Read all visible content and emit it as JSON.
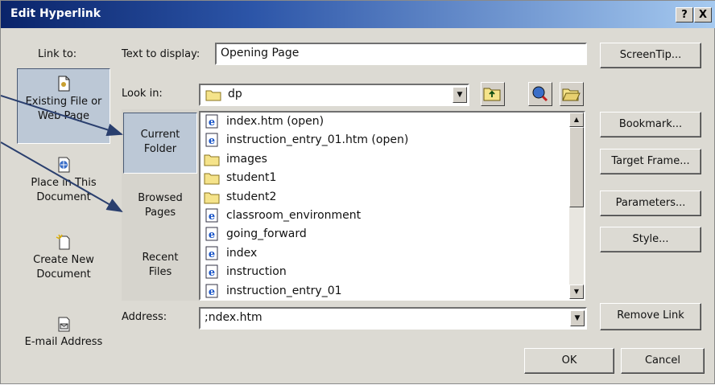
{
  "window": {
    "title": "Edit Hyperlink",
    "help_label": "?",
    "close_label": "X"
  },
  "link_to": {
    "label": "Link to:",
    "items": [
      {
        "name": "existing-file",
        "line1": "Existing File or",
        "line2": "Web Page",
        "icon": "document-icon"
      },
      {
        "name": "place-in-doc",
        "line1": "Place in This",
        "line2": "Document",
        "icon": "globe-document-icon"
      },
      {
        "name": "create-new",
        "line1": "Create New",
        "line2": "Document",
        "icon": "new-document-icon"
      },
      {
        "name": "email",
        "line1": "E-mail Address",
        "line2": "",
        "icon": "email-icon"
      }
    ]
  },
  "text_to_display": {
    "label": "Text to display:",
    "value": "Opening Page"
  },
  "look_in": {
    "label": "Look in:",
    "value": "dp"
  },
  "categories": [
    {
      "line1": "Current",
      "line2": "Folder"
    },
    {
      "line1": "Browsed",
      "line2": "Pages"
    },
    {
      "line1": "Recent",
      "line2": "Files"
    }
  ],
  "files": [
    {
      "name": "index.htm (open)",
      "type": "ie-page-icon"
    },
    {
      "name": "instruction_entry_01.htm (open)",
      "type": "ie-page-icon"
    },
    {
      "name": "images",
      "type": "folder-icon"
    },
    {
      "name": "student1",
      "type": "folder-icon"
    },
    {
      "name": "student2",
      "type": "folder-icon"
    },
    {
      "name": "classroom_environment",
      "type": "ie-page-icon"
    },
    {
      "name": "going_forward",
      "type": "ie-page-icon"
    },
    {
      "name": "index",
      "type": "ie-page-icon"
    },
    {
      "name": "instruction",
      "type": "ie-page-icon"
    },
    {
      "name": "instruction_entry_01",
      "type": "ie-page-icon"
    }
  ],
  "address": {
    "label": "Address:",
    "value": ";ndex.htm"
  },
  "buttons": {
    "screentip": "ScreenTip...",
    "bookmark": "Bookmark...",
    "target_frame": "Target Frame...",
    "parameters": "Parameters...",
    "style": "Style...",
    "remove_link": "Remove Link",
    "ok": "OK",
    "cancel": "Cancel"
  },
  "colors": {
    "title_bar": "#0a246a",
    "selected_place": "#bcc8d6",
    "annotation_arrows": "#2a3f6e"
  }
}
